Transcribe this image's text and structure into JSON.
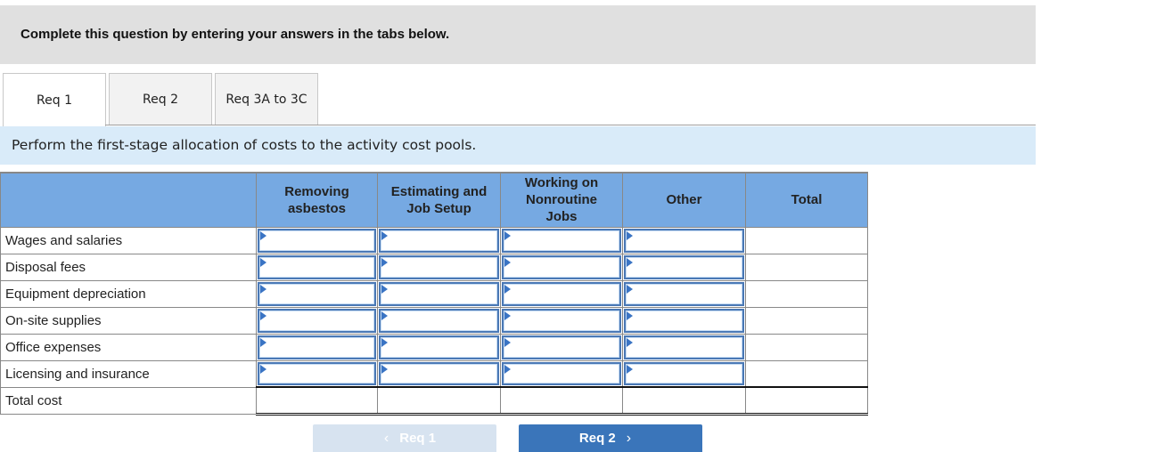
{
  "banner": {
    "text": "Complete this question by entering your answers in the tabs below."
  },
  "tabs": [
    {
      "label": "Req 1",
      "active": true
    },
    {
      "label": "Req 2",
      "active": false
    },
    {
      "label": "Req 3A to 3C",
      "active": false
    }
  ],
  "instruction": "Perform the first-stage allocation of costs to the activity cost pools.",
  "table": {
    "headers": [
      "",
      "Removing asbestos",
      "Estimating and Job Setup",
      "Working on Nonroutine Jobs",
      "Other",
      "Total"
    ],
    "header_lines": [
      [],
      [
        "Removing",
        "asbestos"
      ],
      [
        "Estimating and",
        "Job Setup"
      ],
      [
        "Working on",
        "Nonroutine",
        "Jobs"
      ],
      [
        "Other"
      ],
      [
        "Total"
      ]
    ],
    "rows": [
      {
        "label": "Wages and salaries",
        "values": [
          "",
          "",
          "",
          ""
        ],
        "total": ""
      },
      {
        "label": "Disposal fees",
        "values": [
          "",
          "",
          "",
          ""
        ],
        "total": ""
      },
      {
        "label": "Equipment depreciation",
        "values": [
          "",
          "",
          "",
          ""
        ],
        "total": ""
      },
      {
        "label": "On-site supplies",
        "values": [
          "",
          "",
          "",
          ""
        ],
        "total": ""
      },
      {
        "label": "Office expenses",
        "values": [
          "",
          "",
          "",
          ""
        ],
        "total": ""
      },
      {
        "label": "Licensing and insurance",
        "values": [
          "",
          "",
          "",
          ""
        ],
        "total": ""
      }
    ],
    "total_row": {
      "label": "Total cost",
      "values": [
        "",
        "",
        "",
        "",
        ""
      ]
    }
  },
  "nav": {
    "prev_label": "Req 1",
    "prev_icon": "chevron-left-icon",
    "prev_enabled": false,
    "next_label": "Req 2",
    "next_icon": "chevron-right-icon"
  },
  "colors": {
    "header_bg": "#76a9e2",
    "input_border": "#4a78b5",
    "next_button": "#3a75ba",
    "prev_button_disabled": "#d7e3f0",
    "instruction_bg": "#d9ebf9"
  }
}
